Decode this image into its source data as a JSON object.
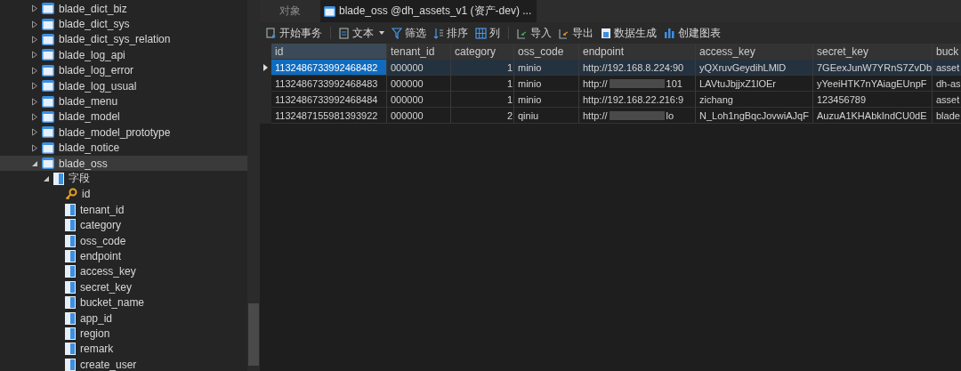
{
  "tree": [
    {
      "label": "blade_dict_biz",
      "expanded": false,
      "selected": false
    },
    {
      "label": "blade_dict_sys",
      "expanded": false,
      "selected": false
    },
    {
      "label": "blade_dict_sys_relation",
      "expanded": false,
      "selected": false
    },
    {
      "label": "blade_log_api",
      "expanded": false,
      "selected": false
    },
    {
      "label": "blade_log_error",
      "expanded": false,
      "selected": false
    },
    {
      "label": "blade_log_usual",
      "expanded": false,
      "selected": false
    },
    {
      "label": "blade_menu",
      "expanded": false,
      "selected": false
    },
    {
      "label": "blade_model",
      "expanded": false,
      "selected": false
    },
    {
      "label": "blade_model_prototype",
      "expanded": false,
      "selected": false
    },
    {
      "label": "blade_notice",
      "expanded": false,
      "selected": false
    },
    {
      "label": "blade_oss",
      "expanded": true,
      "selected": true,
      "children": [
        {
          "label": "字段",
          "expanded": true,
          "selected": false,
          "kind": "group",
          "children": [
            {
              "label": "id",
              "kind": "key",
              "selected": false
            },
            {
              "label": "tenant_id",
              "kind": "column",
              "selected": false
            },
            {
              "label": "category",
              "kind": "column",
              "selected": false
            },
            {
              "label": "oss_code",
              "kind": "column",
              "selected": false
            },
            {
              "label": "endpoint",
              "kind": "column",
              "selected": false
            },
            {
              "label": "access_key",
              "kind": "column",
              "selected": false
            },
            {
              "label": "secret_key",
              "kind": "column",
              "selected": false
            },
            {
              "label": "bucket_name",
              "kind": "column",
              "selected": false
            },
            {
              "label": "app_id",
              "kind": "column",
              "selected": false
            },
            {
              "label": "region",
              "kind": "column",
              "selected": false
            },
            {
              "label": "remark",
              "kind": "column",
              "selected": false
            },
            {
              "label": "create_user",
              "kind": "column",
              "selected": false
            }
          ]
        }
      ]
    }
  ],
  "tabs": [
    {
      "label": "对象",
      "selected": false
    },
    {
      "label": "blade_oss @dh_assets_v1 (资产-dev) ...",
      "selected": true
    }
  ],
  "toolbar": [
    {
      "label": "开始事务",
      "kind": "transaction"
    },
    {
      "kind": "separator"
    },
    {
      "label": "文本",
      "kind": "text"
    },
    {
      "label": "筛选",
      "kind": "filter"
    },
    {
      "label": "排序",
      "kind": "sort"
    },
    {
      "label": "列",
      "kind": "columns"
    },
    {
      "kind": "separator"
    },
    {
      "label": "导入",
      "kind": "import"
    },
    {
      "label": "导出",
      "kind": "export"
    },
    {
      "label": "数据生成",
      "kind": "generate"
    },
    {
      "label": "创建图表",
      "kind": "chart"
    }
  ],
  "table": {
    "columns": [
      {
        "label": "id",
        "selected": true
      },
      {
        "label": "tenant_id",
        "selected": false
      },
      {
        "label": "category",
        "selected": false
      },
      {
        "label": "oss_code",
        "selected": false
      },
      {
        "label": "endpoint",
        "selected": false
      },
      {
        "label": "access_key",
        "selected": false
      },
      {
        "label": "secret_key",
        "selected": false
      },
      {
        "label": "buck",
        "selected": false
      }
    ],
    "rows": [
      {
        "selected": true,
        "cells": [
          {
            "text": "1132486733992468482",
            "selected": true
          },
          {
            "text": "000000"
          },
          {
            "text": "1",
            "kind": "number"
          },
          {
            "text": "minio"
          },
          {
            "text": "http://192.168.8.224:90"
          },
          {
            "text": "yQXruvGeydihLMlD"
          },
          {
            "text": "7GEexJunW7YRnS7ZvDb"
          },
          {
            "text": "asset"
          }
        ]
      },
      {
        "selected": false,
        "cells": [
          {
            "text": "1132486733992468483"
          },
          {
            "text": "000000"
          },
          {
            "text": "1",
            "kind": "number"
          },
          {
            "text": "minio"
          },
          {
            "text": "http://",
            "end": "101",
            "kind": "redacted"
          },
          {
            "text": "LAVtuJbjjxZ1lOEr"
          },
          {
            "text": "yYeeiHTK7nYAiagEUnpF"
          },
          {
            "text": "dh-as"
          }
        ]
      },
      {
        "selected": false,
        "cells": [
          {
            "text": "1132486733992468484"
          },
          {
            "text": "000000"
          },
          {
            "text": "1",
            "kind": "number"
          },
          {
            "text": "minio"
          },
          {
            "text": "http://192.168.22.216:9"
          },
          {
            "text": "zichang"
          },
          {
            "text": "123456789"
          },
          {
            "text": "asset"
          }
        ]
      },
      {
        "selected": false,
        "cells": [
          {
            "text": "1132487155981393922"
          },
          {
            "text": "000000"
          },
          {
            "text": "2",
            "kind": "number"
          },
          {
            "text": "qiniu"
          },
          {
            "text": "http://",
            "end": "lo",
            "kind": "redacted"
          },
          {
            "text": "N_Loh1ngBqcJovwiAJqF"
          },
          {
            "text": "AuzuA1KHAbkIndCU0dE"
          },
          {
            "text": "blade"
          }
        ]
      }
    ]
  }
}
